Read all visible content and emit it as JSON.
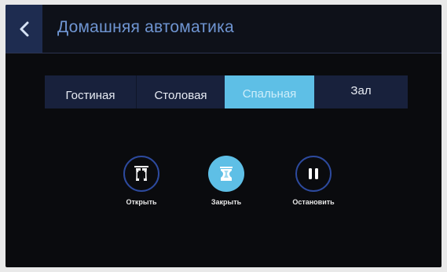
{
  "header": {
    "back_icon": "chevron-left-icon",
    "title": "Домашняя автоматика"
  },
  "tabs": [
    {
      "label": "Гостиная",
      "active": false
    },
    {
      "label": "Столовая",
      "active": false
    },
    {
      "label": "Спальная",
      "active": true
    },
    {
      "label": "Зал",
      "active": false
    }
  ],
  "controls": {
    "open": {
      "label": "Открыть",
      "icon": "curtain-open-icon",
      "style": "outline"
    },
    "close": {
      "label": "Закрыть",
      "icon": "curtain-closed-icon",
      "style": "filled"
    },
    "stop": {
      "label": "Остановить",
      "icon": "pause-icon",
      "style": "outline"
    }
  },
  "colors": {
    "accent": "#5ebfe6",
    "title_text": "#6f95d2",
    "header_bar": "#0e1119",
    "back_button": "#1e2c50",
    "tab_bar": "#18213c",
    "circle_outline": "#2d4a9e",
    "screen_background": "#0a0b0e"
  }
}
